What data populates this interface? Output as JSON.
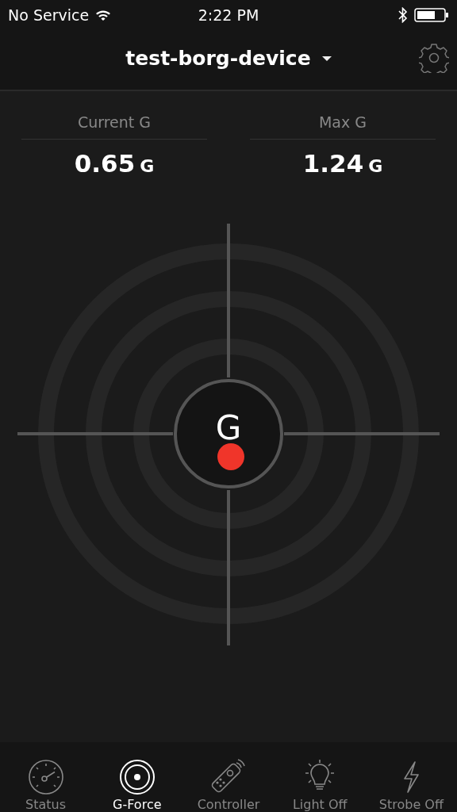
{
  "status_bar": {
    "carrier": "No Service",
    "time": "2:22 PM"
  },
  "header": {
    "title": "test-borg-device"
  },
  "stats": [
    {
      "label": "Current G",
      "value": "0.65",
      "unit": "G"
    },
    {
      "label": "Max G",
      "value": "1.24",
      "unit": "G"
    }
  ],
  "target": {
    "center_label": "G"
  },
  "tabs": [
    {
      "label": "Status",
      "kind": "gauge",
      "selected": false
    },
    {
      "label": "G-Force",
      "kind": "target",
      "selected": true
    },
    {
      "label": "Controller",
      "kind": "remote",
      "selected": false
    },
    {
      "label": "Light Off",
      "kind": "bulb",
      "selected": false
    },
    {
      "label": "Strobe Off",
      "kind": "bolt",
      "selected": false
    }
  ]
}
